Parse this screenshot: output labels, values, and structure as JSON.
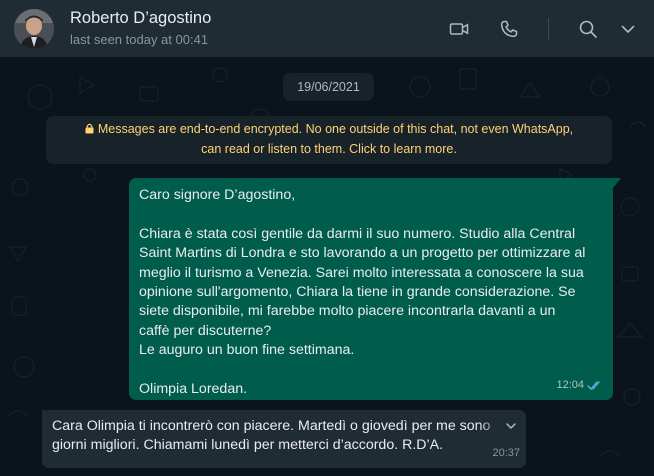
{
  "header": {
    "contact_name": "Roberto D’agostino",
    "status": "last seen today at 00:41",
    "icons": [
      "video-call-icon",
      "voice-call-icon",
      "search-icon",
      "chevron-down-icon"
    ]
  },
  "chat": {
    "date_chip": "19/06/2021",
    "encryption_notice": {
      "icon": "lock-icon",
      "line1": "Messages are end-to-end encrypted. No one outside of this chat, not even WhatsApp,",
      "line2": "can read or listen to them. Click to learn more."
    },
    "outgoing_message": {
      "greeting": "Caro signore D’agostino,",
      "line1": "Chiara è stata così gentile da darmi il suo numero. Studio alla Central",
      "line2": "Saint Martins di Londra e sto lavorando a un progetto per ottimizzare al",
      "line3": "meglio il turismo a Venezia. Sarei molto interessata a conoscere la sua",
      "line4": "opinione sull'argomento, Chiara la tiene in grande considerazione. Se",
      "line5": "siete disponibile, mi farebbe molto piacere incontrarla davanti a un",
      "line6": "caffè per discuterne?",
      "line7": "Le auguro un buon fine settimana.",
      "signature": "Olimpia Loredan.",
      "time": "12:04",
      "status_icon": "double-check-icon"
    },
    "incoming_message": {
      "line1": "Cara Olimpia ti incontrerò con piacere. Martedì o giovedì per me sono",
      "line2": "giorni migliori. Chiamami lunedì per metterci d’accordo. R.D’A.",
      "time": "20:37",
      "menu_icon": "chevron-down-icon"
    }
  },
  "colors": {
    "header_bg": "#202c33",
    "chat_bg": "#0b141a",
    "outgoing_bubble": "#005c4b",
    "incoming_bubble": "#202c33",
    "notice_text": "#ffd279",
    "read_ticks": "#53bdeb"
  }
}
